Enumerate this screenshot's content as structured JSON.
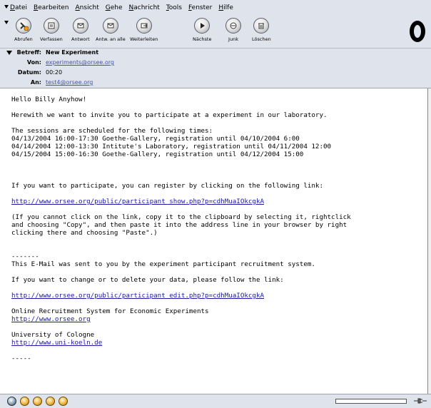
{
  "menu": {
    "items": [
      {
        "first": "D",
        "rest": "atei"
      },
      {
        "first": "B",
        "rest": "earbeiten"
      },
      {
        "first": "A",
        "rest": "nsicht"
      },
      {
        "first": "G",
        "rest": "ehe"
      },
      {
        "first": "N",
        "rest": "achricht"
      },
      {
        "first": "T",
        "rest": "ools"
      },
      {
        "first": "F",
        "rest": "enster"
      },
      {
        "first": "H",
        "rest": "ilfe"
      }
    ]
  },
  "toolbar": {
    "abrufen": "Abrufen",
    "verfassen": "Verfassen",
    "antwort": "Antwort",
    "antw_alle": "Antw. an alle",
    "weiterleiten": "Weiterleiten",
    "naechste": "Nächste",
    "junk": "Junk",
    "loeschen": "Löschen"
  },
  "header": {
    "subject_label": "Betreff:",
    "subject": "New Experiment",
    "from_label": "Von:",
    "from": "experiments@orsee.org",
    "date_label": "Datum:",
    "date": "00:20",
    "to_label": "An:",
    "to": "test4@orsee.org"
  },
  "body": {
    "greeting": "Hello Billy Anyhow!",
    "invite": "Herewith we want to invite you to participate at a experiment in our laboratory.",
    "sessions_intro": "The sessions are scheduled for the following times:",
    "sessions": [
      "04/13/2004 16:00-17:30 Goethe-Gallery, registration until 04/10/2004 6:00",
      "04/14/2004 12:00-13:30 Intitute's Laboratory, registration until 04/11/2004 12:00",
      "04/15/2004 15:00-16:30 Goethe-Gallery, registration until 04/12/2004 15:00"
    ],
    "register_text": "If you want to participate, you can register by clicking on the following link:",
    "register_link": "http://www.orsee.org/public/participant_show.php?p=cdhMuaIOkcgkA",
    "copy_hint": [
      "(If you cannot click on the link, copy it to the clipboard by selecting it, rightclick",
      "and choosing \"Copy\", and then paste it into the address line in your browser by right",
      "clicking there and choosing \"Paste\".)"
    ],
    "separator": "-------",
    "system_note": "This E-Mail was sent to you by the experiment participant recruitment system.",
    "change_text": "If you want to change or to delete your data, please follow the link:",
    "edit_link": "http://www.orsee.org/public/participant_edit.php?p=cdhMuaIOkcgkA",
    "orsee_name": "Online Recruitment System for Economic Experiments",
    "orsee_link": "http://www.orsee.org",
    "uni_name": "University of Cologne",
    "uni_link": "http://www.uni-koeln.de",
    "end_separator": "-----"
  }
}
